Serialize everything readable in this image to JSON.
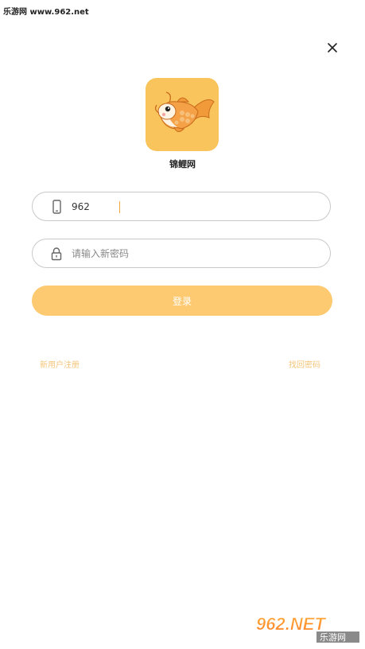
{
  "watermark_top": "乐游网 www.962.net",
  "app": {
    "name": "锦鲤网"
  },
  "form": {
    "phone_value": "962",
    "password_placeholder": "请输入新密码",
    "login_label": "登录"
  },
  "links": {
    "register": "新用户注册",
    "forgot": "找回密码"
  },
  "watermark_bottom": {
    "top_text": "962.NET",
    "bottom_text": "乐游网"
  },
  "icons": {
    "close": "close-icon",
    "phone": "phone-icon",
    "lock": "lock-icon"
  },
  "colors": {
    "accent": "#fdc971",
    "link": "#f4c57a",
    "logo_bg": "#f8c45b"
  }
}
